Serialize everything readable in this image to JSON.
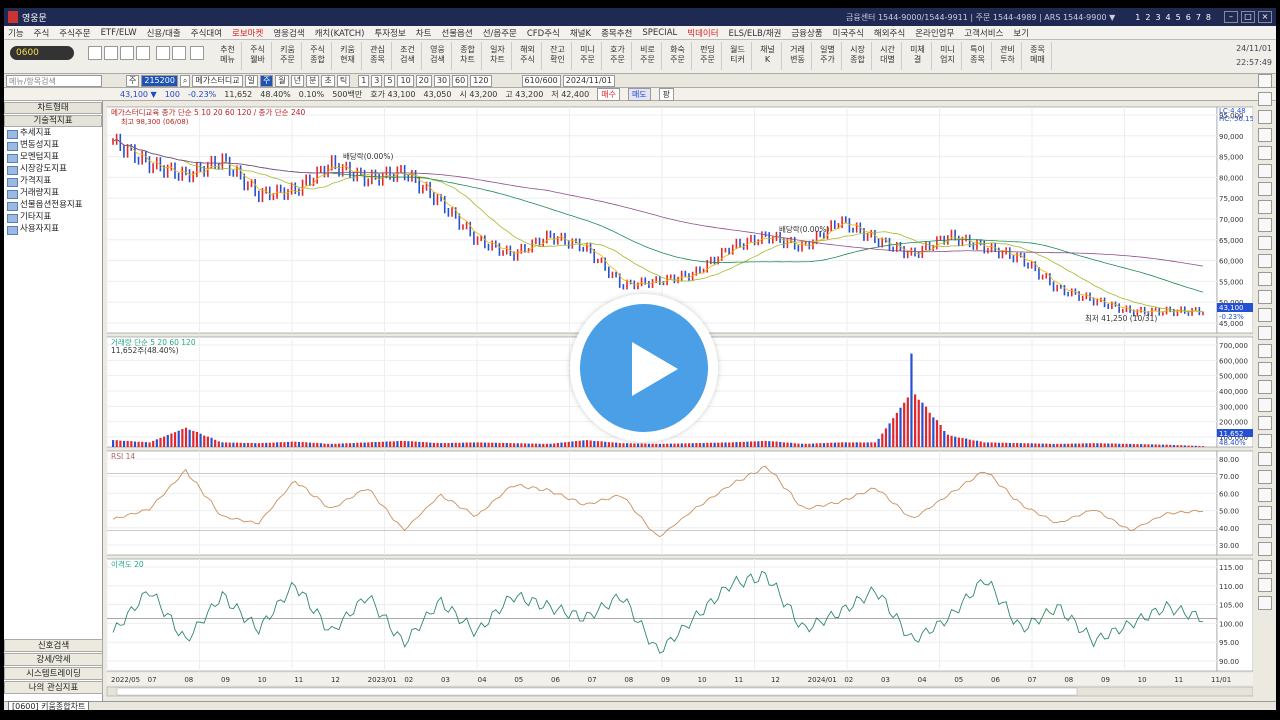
{
  "window": {
    "title": "영웅문",
    "center_info": "금융센터 1544-9000/1544-9911 | 주문 1544-4989 | ARS 1544-9900 ▼",
    "pages": [
      "1",
      "2",
      "3",
      "4",
      "5",
      "6",
      "7",
      "8"
    ]
  },
  "menu": [
    "기능",
    "주식",
    "주식주문",
    "ETF/ELW",
    "신용/대출",
    "주식대여",
    "로보마켓",
    "영웅검색",
    "캐치(KATCH)",
    "투자정보",
    "차트",
    "선물옵션",
    "선/옵주문",
    "CFD주식",
    "채널K",
    "종목추천",
    "SPECIAL",
    "빅데이터",
    "ELS/ELB/채권",
    "금융상품",
    "미국주식",
    "해외주식",
    "온라인업무",
    "고객서비스",
    "보기"
  ],
  "toolbar": {
    "code": "0600",
    "buttons": [
      "추천\n메뉴",
      "주식\n웰바",
      "키움\n주문",
      "주식\n종합",
      "키움\n현재",
      "관심\n종목",
      "조건\n검색",
      "영웅\n검색",
      "종합\n차트",
      "일자\n차트",
      "해외\n주식",
      "잔고\n확인",
      "미니\n주문",
      "호가\n주문",
      "비로\n주문",
      "화숙\n주문",
      "펀딩\n주문",
      "월드\n티커",
      "채널\nK",
      "거래\n변동",
      "일별\n주가",
      "시장\n종합",
      "시간\n대별",
      "미체\n결",
      "미니\n업지",
      "특이\n종목",
      "관비\n투하",
      "종목\n메매"
    ],
    "date": "24/11/01",
    "time": "22:57:49"
  },
  "options": {
    "search_placeholder": "메뉴/항목검색",
    "period_buttons": [
      "일",
      "주",
      "월",
      "년",
      "분",
      "초",
      "틱"
    ],
    "counts": [
      "1",
      "3",
      "5",
      "10",
      "20",
      "30",
      "60",
      "120"
    ],
    "code": "215200",
    "name": "메가스터디교",
    "range": "610/600",
    "date": "2024/11/01"
  },
  "quote": {
    "price": "43,100 ▼",
    "change": "100",
    "pct": "-0.23%",
    "volume": "11,652",
    "vol_ratio": "48.40%",
    "extra": "0.10%",
    "unit": "500백만",
    "ask": "호가 43,100",
    "bid": "43,050",
    "high_label": "시 43,200",
    "high2": "고 43,200",
    "low": "저 42,400",
    "buy": "매수",
    "sell": "매도",
    "x": "팡"
  },
  "sidebar": {
    "tab": "차트형태",
    "header": "기술적지표",
    "items": [
      "추세지표",
      "변동성지표",
      "모멘텀지표",
      "시장강도지표",
      "가격지표",
      "거래량지표",
      "선물옵션전용지표",
      "기타지표",
      "사용자지표"
    ],
    "bottom": [
      "신호검색",
      "강세/약세",
      "시스템트레이딩",
      "나의 관심지표"
    ]
  },
  "status": {
    "tab": "[0600] 키움종합차트"
  },
  "chart_data": [
    {
      "type": "line",
      "title": "메가스터디교육",
      "legend": "종가 단순 5 10 20 60 120 / 종가 단순 240",
      "ylim": [
        40000,
        95000
      ],
      "yticks": [
        "95,000",
        "90,000",
        "85,000",
        "80,000",
        "75,000",
        "70,000",
        "65,000",
        "60,000",
        "55,000",
        "50,000",
        "45,000"
      ],
      "annotations": [
        "최고 98,300 (06/08)",
        "배당락(0.00%)",
        "배당락(0.00%)",
        "최저 41,250 (10/31)"
      ],
      "right_labels": [
        "LC:4.48",
        "HC:-56.15",
        "43,100",
        "-0.23%"
      ],
      "x": [
        "2022/05",
        "07",
        "08",
        "09",
        "10",
        "11",
        "12",
        "2023/01",
        "02",
        "03",
        "04",
        "05",
        "06",
        "07",
        "08",
        "09",
        "10",
        "11",
        "12",
        "2024/01",
        "02",
        "03",
        "04",
        "05",
        "06",
        "07",
        "08",
        "09",
        "10",
        "11",
        "11/01"
      ],
      "series": [
        {
          "name": "price",
          "values": [
            88000,
            82000,
            79000,
            83000,
            74000,
            75000,
            82000,
            78000,
            80000,
            72000,
            62000,
            58000,
            63000,
            60000,
            50000,
            51000,
            53000,
            60000,
            63000,
            60000,
            67000,
            62000,
            58000,
            63000,
            60000,
            57000,
            49000,
            46000,
            43000,
            43100,
            43100
          ]
        }
      ]
    },
    {
      "type": "bar",
      "title": "거래량 단순 5 20 60 120",
      "label": "11,652주(48.40%)",
      "yticks": [
        "700,000",
        "600,000",
        "500,000",
        "400,000",
        "300,000",
        "200,000",
        "100,000"
      ],
      "right_labels": [
        "11,652",
        "48.40%"
      ],
      "values": [
        90000,
        60000,
        250000,
        60000,
        50000,
        70000,
        40000,
        60000,
        80000,
        50000,
        60000,
        50000,
        40000,
        90000,
        50000,
        40000,
        50000,
        60000,
        80000,
        40000,
        60000,
        60000,
        730000,
        150000,
        60000,
        50000,
        40000,
        50000,
        40000,
        30000,
        11652
      ]
    },
    {
      "type": "line",
      "title": "RSI 14",
      "ylim": [
        20,
        80
      ],
      "yticks": [
        "80.00",
        "70.00",
        "60.00",
        "50.00",
        "40.00",
        "30.00"
      ],
      "values": [
        38,
        45,
        72,
        40,
        35,
        65,
        45,
        60,
        30,
        55,
        40,
        62,
        58,
        48,
        55,
        25,
        45,
        62,
        75,
        45,
        50,
        60,
        38,
        55,
        72,
        48,
        35,
        45,
        30,
        42,
        44
      ]
    },
    {
      "type": "line",
      "title": "이격도 20",
      "ylim": [
        85,
        118
      ],
      "yticks": [
        "115.00",
        "110.00",
        "105.00",
        "100.00",
        "95.00",
        "90.00"
      ],
      "values": [
        95,
        110,
        92,
        108,
        96,
        112,
        95,
        108,
        91,
        106,
        95,
        108,
        104,
        100,
        108,
        88,
        100,
        112,
        115,
        96,
        102,
        110,
        92,
        100,
        114,
        96,
        104,
        92,
        98,
        104,
        100
      ]
    }
  ],
  "colors": {
    "up": "#e4262b",
    "down": "#2450d3",
    "ma5": "#f5b400",
    "ma10": "#ff8f3a",
    "ma20": "#a3ba28",
    "ma60": "#1a8a52",
    "ma120": "#8e4b8e",
    "ma240": "#a0343f",
    "rsi": "#c8905c",
    "dispar": "#2f8a63",
    "accent": "#4b9fe6"
  }
}
